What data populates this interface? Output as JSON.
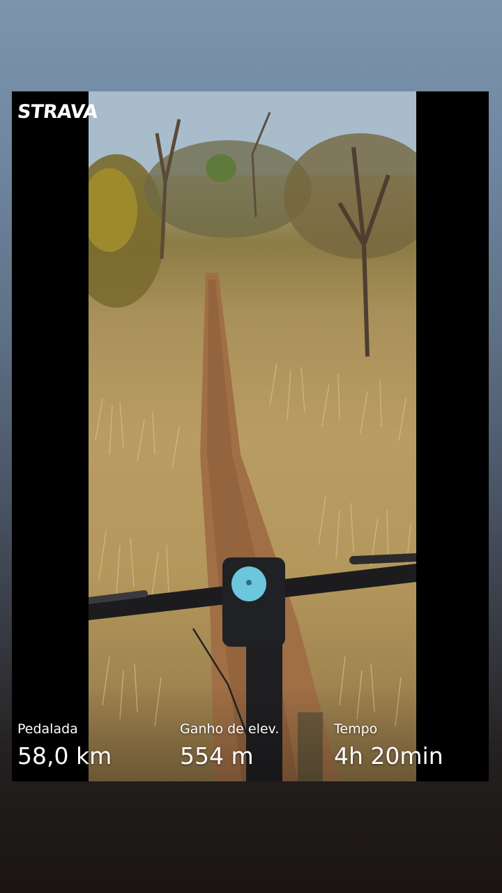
{
  "brand": {
    "logo_text": "STRAVA"
  },
  "stats": [
    {
      "label": "Pedalada",
      "value": "58,0 km"
    },
    {
      "label": "Ganho de elev.",
      "value": "554 m"
    },
    {
      "label": "Tempo",
      "value": "4h 20min"
    }
  ],
  "colors": {
    "card_background": "#000000",
    "text": "#ffffff",
    "mount_accent": "#6cc6dc"
  }
}
